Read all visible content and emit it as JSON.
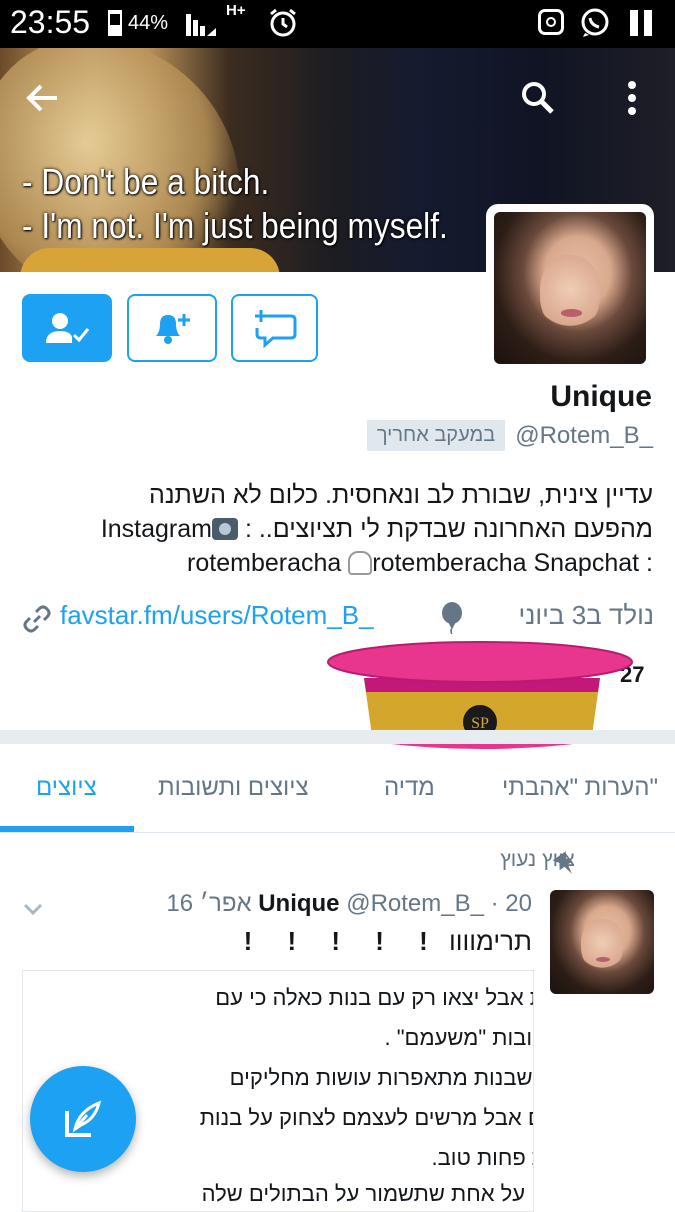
{
  "status_bar": {
    "time": "23:55",
    "battery": "44%",
    "network": "H+",
    "icons": [
      "battery-icon",
      "signal-icon",
      "alarm-icon",
      "instagram-icon",
      "whatsapp-icon",
      "pause-icon"
    ]
  },
  "header": {
    "caption_line1": "- Don't be a bitch.",
    "caption_line2": "- I'm not. I'm just being myself.",
    "back_icon": "back-arrow-icon",
    "search_icon": "search-icon",
    "more_icon": "more-vert-icon"
  },
  "profile": {
    "name": "Unique",
    "handle": "@Rotem_B_",
    "follows_you": "במעקב אחריך",
    "bio_line1": "עדיין צינית, שבורת לב ונאחסית. כלום לא השתנה",
    "bio_line2_a": "מהפעם האחרונה שבדקת לי תציוצים.. :",
    "bio_line2_b": "Instagram",
    "bio_line3_a": "rotemberacha Snapchat",
    "bio_line3_b": ": rotemberacha",
    "link": "favstar.fm/users/Rotem_B_",
    "birthday": "נולד ב3 ביוני",
    "stats_partial": "27"
  },
  "tabs": {
    "tweets": "ציוצים",
    "tweets_replies": "ציוצים ותשובות",
    "media": "מדיה",
    "likes": "הערות \"אהבתי\""
  },
  "tweet": {
    "pinned_label": "ציוץ נעוץ",
    "name": "Unique",
    "handle": "@Rotem_B_",
    "date": "· 20 אפר׳ 16",
    "text": "תרימוווו",
    "exclaims": "! ! ! ! !",
    "media_lines": [
      "ומעשנת אבל יצאו רק עם בנות כאלה כי עם",
      "ילדות טובות \"משעמם\" .",
      "שונאים שבנות מתאפרות עושות מחליקים",
      "וניתוחים אבל מרשים לעצמם לצחוק על בנות",
      "שנראות פחות טוב.",
      "מדברים על אחת שתשמור על הבתולים שלה"
    ]
  },
  "colors": {
    "accent": "#1da1f2",
    "secondary_text": "#657786",
    "primary_text": "#14171a",
    "hat_pink": "#e8368f",
    "hat_gold": "#d4a72c"
  },
  "sticker": {
    "hat_badge": "SP"
  }
}
